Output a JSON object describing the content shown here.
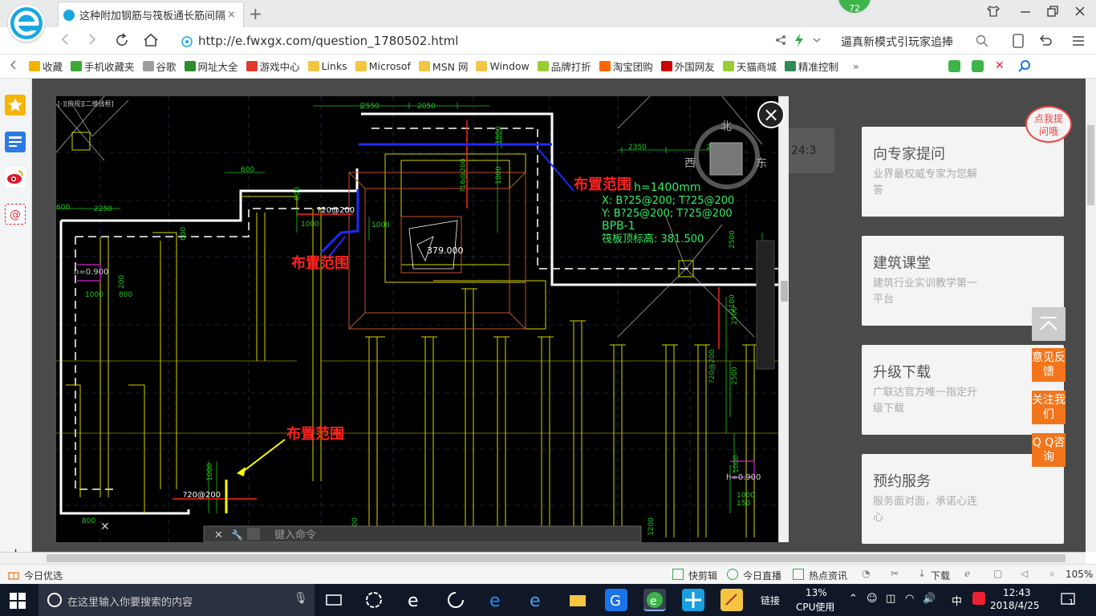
{
  "browser": {
    "tab_title": "这种附加钢筋与筏板通长筋间隔",
    "tab_close": "×",
    "new_tab": "+",
    "badge_count": "72",
    "url": "http://e.fwxgx.com/question_1780502.html",
    "search_text": "逼真新模式引玩家追捧"
  },
  "bookmarks": [
    {
      "label": "收藏",
      "color": "#f5b400"
    },
    {
      "label": "手机收藏夹",
      "color": "#3aaa35"
    },
    {
      "label": "谷歌",
      "color": "#9e9e9e"
    },
    {
      "label": "网址大全",
      "color": "#2e8b2e"
    },
    {
      "label": "游戏中心",
      "color": "#e23b2e"
    },
    {
      "label": "Links",
      "color": "#f2c542"
    },
    {
      "label": "Microsof",
      "color": "#f2c542"
    },
    {
      "label": "MSN 网",
      "color": "#f2c542"
    },
    {
      "label": "Window",
      "color": "#f2c542"
    },
    {
      "label": "品牌打折",
      "color": "#9acd32"
    },
    {
      "label": "淘宝团购",
      "color": "#ff6600"
    },
    {
      "label": "外国网友",
      "color": "#cc0000"
    },
    {
      "label": "天猫商城",
      "color": "#9acd32"
    },
    {
      "label": "精准控制",
      "color": "#2e8b57"
    }
  ],
  "bookmarks_more": "»",
  "cad": {
    "labels": [
      "布置范围",
      "布置范围",
      "布置范围"
    ],
    "slab_info": [
      "h=1400mm",
      "X: B?25@200; T?25@200",
      "Y: B?25@200; T?25@200",
      "BPB-1",
      "筏板顶标高: 381.500"
    ],
    "elev_379": "379.000",
    "compass": {
      "n": "北",
      "w": "西",
      "e": "东"
    },
    "dims": [
      "2550",
      "2050",
      "2350",
      "2350",
      "600",
      "2250",
      "2500",
      "1800",
      "1800",
      "1000",
      "1000",
      "800",
      "600",
      "2500",
      "2100",
      "2500",
      "1000",
      "1000",
      "800",
      "1200",
      "1200",
      "?20@200",
      "?20@200",
      "?20@200",
      "?16@200",
      "h=0.900",
      "h=0.900"
    ],
    "cmd_prompt": "键入命令",
    "side_time": "24:3"
  },
  "cards": [
    {
      "title": "向专家提问",
      "desc": "业界最权威专家为您解答"
    },
    {
      "title": "建筑课堂",
      "desc": "建筑行业实训教学第一平台"
    },
    {
      "title": "升级下载",
      "desc": "广联达官方唯一指定升级下载"
    },
    {
      "title": "预约服务",
      "desc": "服务面对面，承诺心连心"
    }
  ],
  "bubble": "点我提问哦",
  "float_buttons": [
    "意见反馈",
    "关注我们",
    "Q Q咨询"
  ],
  "statusbar": {
    "left": "今日优选",
    "items": [
      "快剪辑",
      "今日直播",
      "热点资讯"
    ],
    "download": "下载",
    "zoom": "105%"
  },
  "taskbar": {
    "search_placeholder": "在这里输入你要搜索的内容",
    "link": "链接",
    "cpu_percent": "13%",
    "cpu_label": "CPU使用",
    "ime": "中",
    "time": "12:43",
    "date": "2018/4/25",
    "notif_count": "1"
  }
}
